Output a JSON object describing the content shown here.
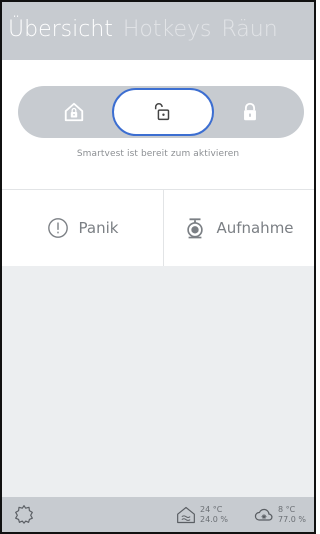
{
  "header": {
    "tabs": [
      {
        "label": "Übersicht",
        "active": true
      },
      {
        "label": "Hotkeys",
        "active": false
      },
      {
        "label": "Räun",
        "active": false
      }
    ]
  },
  "mode": {
    "options": [
      {
        "name": "home-lock",
        "icon": "home-lock-icon"
      },
      {
        "name": "unlocked",
        "icon": "unlock-icon",
        "selected": true
      },
      {
        "name": "locked",
        "icon": "lock-icon"
      }
    ],
    "status": "Smartvest ist bereit zum aktivieren"
  },
  "actions": {
    "panic_label": "Panik",
    "record_label": "Aufnahme"
  },
  "footer": {
    "indoor": {
      "temperature": "24 °C",
      "humidity": "24.0 %"
    },
    "outdoor": {
      "temperature": "8 °C",
      "humidity": "77.0 %"
    }
  },
  "colors": {
    "bar": "#c7cbd0",
    "accent": "#3c6ed1",
    "content_bg": "#eceef0",
    "text_muted": "#7b7f84"
  }
}
